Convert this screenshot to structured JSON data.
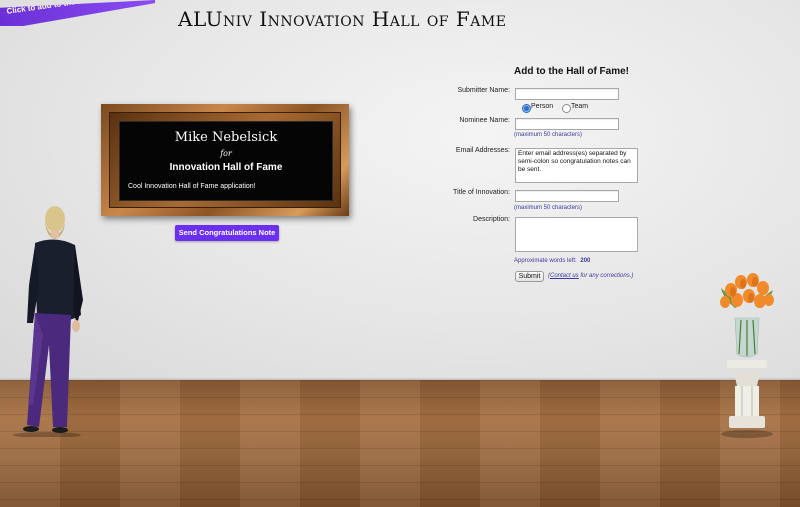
{
  "ribbon": {
    "label": "Click to add to the Wall!"
  },
  "page": {
    "title": "ALUniv Innovation Hall of Fame"
  },
  "plaque": {
    "name": "Mike Nebelsick",
    "for_text": "for",
    "hall": "Innovation Hall of Fame",
    "description": "Cool Innovation Hall of Fame application!"
  },
  "send_button": {
    "label": "Send Congratulations Note"
  },
  "form": {
    "title": "Add to the Hall of Fame!",
    "submitter_label": "Submitter Name:",
    "submitter_value": "",
    "type_options": [
      {
        "label": "Person",
        "selected": true
      },
      {
        "label": "Team",
        "selected": false
      }
    ],
    "nominee_label": "Nominee Name:",
    "nominee_value": "",
    "nominee_hint": "(maximum 50 characters)",
    "email_label": "Email Addresses:",
    "email_value": "Enter email address(es) separated by semi-colon so congratulation notes can be sent.",
    "innovation_label": "Title of Innovation:",
    "innovation_value": "",
    "innovation_hint": "(maximum 50 characters)",
    "description_label": "Description:",
    "description_value": "",
    "words_left_label": "Approximate words left:",
    "words_left": "200",
    "submit_label": "Submit",
    "contact_link": "Contact us",
    "contact_rest": " for any corrections.)",
    "contact_open": "("
  },
  "icons": {
    "woman": "woman-figure-icon",
    "vase": "flower-vase-icon"
  }
}
